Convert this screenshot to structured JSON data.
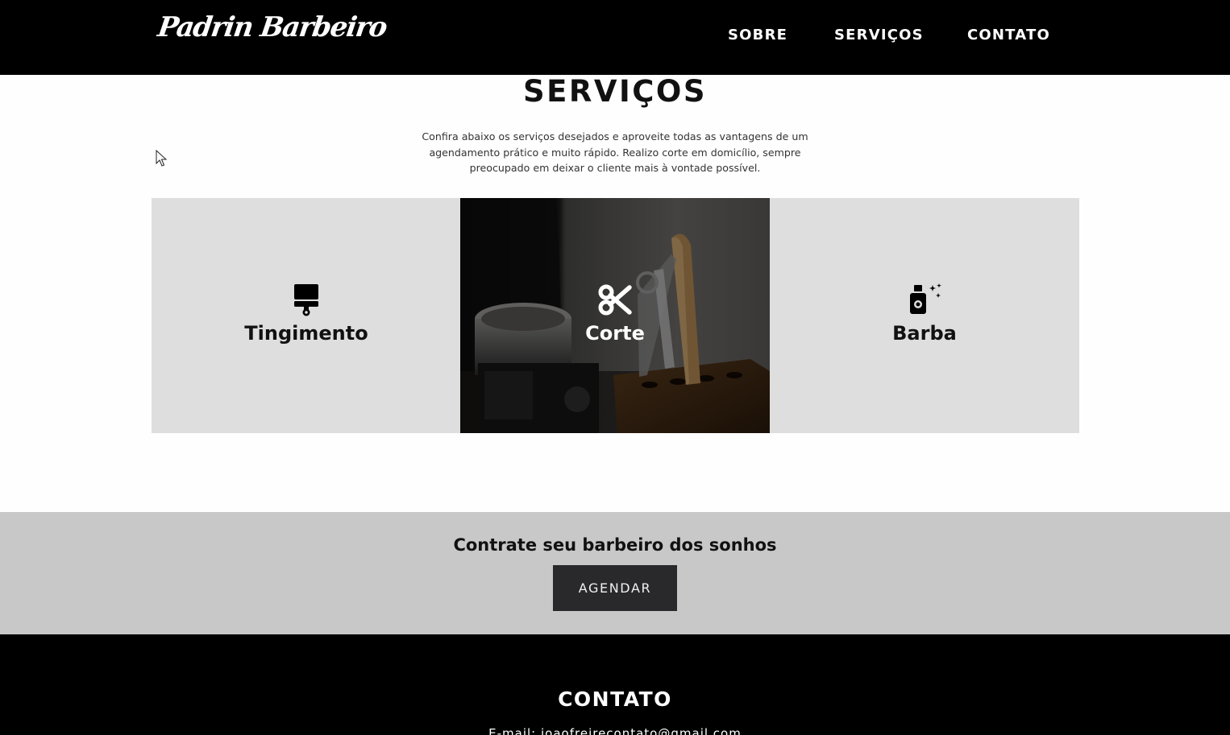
{
  "header": {
    "logo": "Padrin Barbeiro",
    "nav": [
      {
        "label": "SOBRE"
      },
      {
        "label": "SERVIÇOS"
      },
      {
        "label": "CONTATO"
      }
    ]
  },
  "services": {
    "title": "SERVIÇOS",
    "description": "Confira abaixo os serviços desejados e aproveite todas as vantagens de um agendamento prático e muito rápido. Realizo corte em domicílio, sempre preocupado em deixar o cliente mais à vontade possível.",
    "cards": [
      {
        "label": "Tingimento",
        "icon": "paint-brush-icon"
      },
      {
        "label": "Corte",
        "icon": "scissors-icon"
      },
      {
        "label": "Barba",
        "icon": "spray-bottle-icon"
      }
    ]
  },
  "cta": {
    "title": "Contrate seu barbeiro dos sonhos",
    "button": "AGENDAR"
  },
  "footer": {
    "title": "CONTATO",
    "email": "E-mail: joaofreirecontato@gmail.com"
  },
  "colors": {
    "header_bg": "#000000",
    "card_bg": "#dedede",
    "cta_bg": "#c8c8c8",
    "button_bg": "#29292b"
  }
}
